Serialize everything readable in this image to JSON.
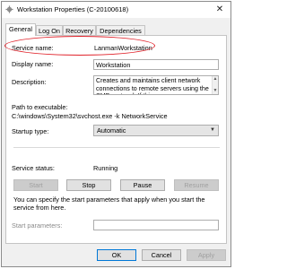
{
  "window": {
    "title": "Workstation Properties (C-20100618)",
    "close_glyph": "✕"
  },
  "tabs": [
    {
      "label": "General"
    },
    {
      "label": "Log On"
    },
    {
      "label": "Recovery"
    },
    {
      "label": "Dependencies"
    }
  ],
  "general": {
    "service_name_label": "Service name:",
    "service_name_value": "LanmanWorkstation",
    "display_name_label": "Display name:",
    "display_name_value": "Workstation",
    "description_label": "Description:",
    "description_value": "Creates and maintains client network connections to remote servers using the SMB protocol. If this",
    "path_label": "Path to executable:",
    "path_value": "C:\\windows\\System32\\svchost.exe -k NetworkService",
    "startup_type_label": "Startup type:",
    "startup_type_value": "Automatic",
    "service_status_label": "Service status:",
    "service_status_value": "Running",
    "buttons": {
      "start": "Start",
      "stop": "Stop",
      "pause": "Pause",
      "resume": "Resume"
    },
    "help_text": "You can specify the start parameters that apply when you start the service from here.",
    "start_parameters_label": "Start parameters:",
    "start_parameters_value": ""
  },
  "footer": {
    "ok": "OK",
    "cancel": "Cancel",
    "apply": "Apply"
  },
  "colors": {
    "highlight_oval": "#e0222a",
    "accent": "#0078d7"
  }
}
